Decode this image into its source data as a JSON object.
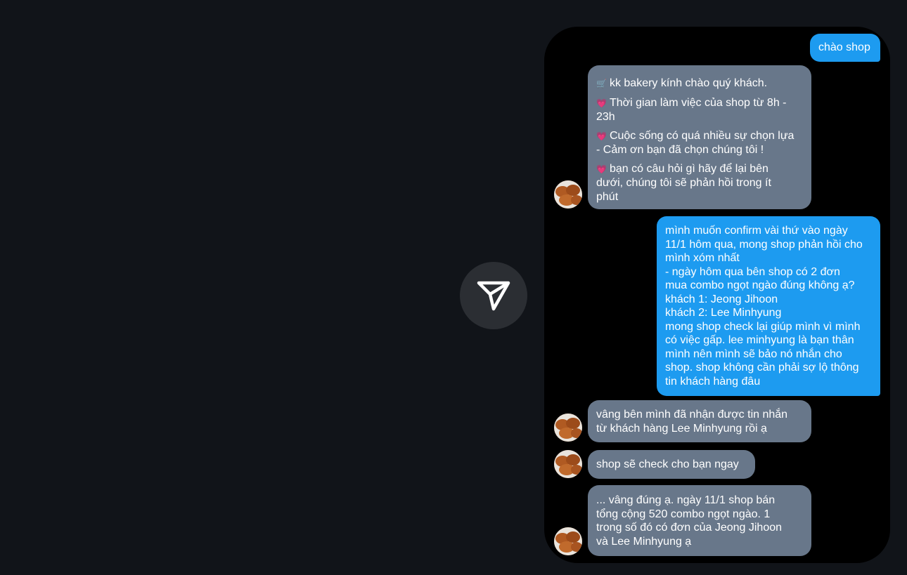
{
  "send_icon": "paper-plane-icon",
  "colors": {
    "page_bg": "#111419",
    "me_bubble": "#1d9bf0",
    "shop_bubble": "#68778a",
    "phone_bg": "#000000"
  },
  "messages": [
    {
      "from": "me",
      "text": "chào shop"
    },
    {
      "from": "shop",
      "lines": [
        {
          "emoji": "🛒",
          "text": "kk bakery kính chào quý khách."
        },
        {
          "emoji": "💗",
          "text": "Thời gian làm việc của shop từ 8h -"
        },
        {
          "text": "23h"
        },
        {
          "emoji": "💗",
          "text": "Cuộc sống có quá nhiều sự chọn lựa"
        },
        {
          "text": "- Cảm ơn bạn đã chọn chúng tôi !"
        },
        {
          "emoji": "💗",
          "text": "bạn có câu hỏi gì hãy để lại bên"
        },
        {
          "text": "dưới, chúng tôi sẽ phản hồi trong ít"
        },
        {
          "text": "phút"
        }
      ]
    },
    {
      "from": "me",
      "lines": [
        "mình muốn confirm vài thứ vào ngày",
        "11/1 hôm qua, mong shop phản hồi cho",
        "mình xóm nhất",
        "- ngày hôm qua bên shop có 2 đơn",
        "mua combo ngọt ngào đúng không ạ?",
        "khách 1: Jeong Jihoon",
        "khách 2: Lee Minhyung",
        "mong shop check lại giúp mình vì mình",
        "có việc gấp. lee minhyung là bạn thân",
        "mình nên mình sẽ bảo nó nhắn cho",
        "shop. shop không cần phải sợ lộ thông",
        "tin khách hàng đâu"
      ]
    },
    {
      "from": "shop",
      "lines": [
        "vâng bên mình đã nhận được tin nhắn",
        "từ khách hàng Lee Minhyung rồi ạ"
      ]
    },
    {
      "from": "shop",
      "lines": [
        "shop sẽ check cho bạn ngay"
      ]
    },
    {
      "from": "shop",
      "lines": [
        "... vâng đúng ạ. ngày 11/1 shop bán",
        "tổng cộng 520 combo ngọt ngào. 1",
        "trong số đó có đơn của Jeong Jihoon",
        "và Lee Minhyung ạ"
      ]
    }
  ]
}
